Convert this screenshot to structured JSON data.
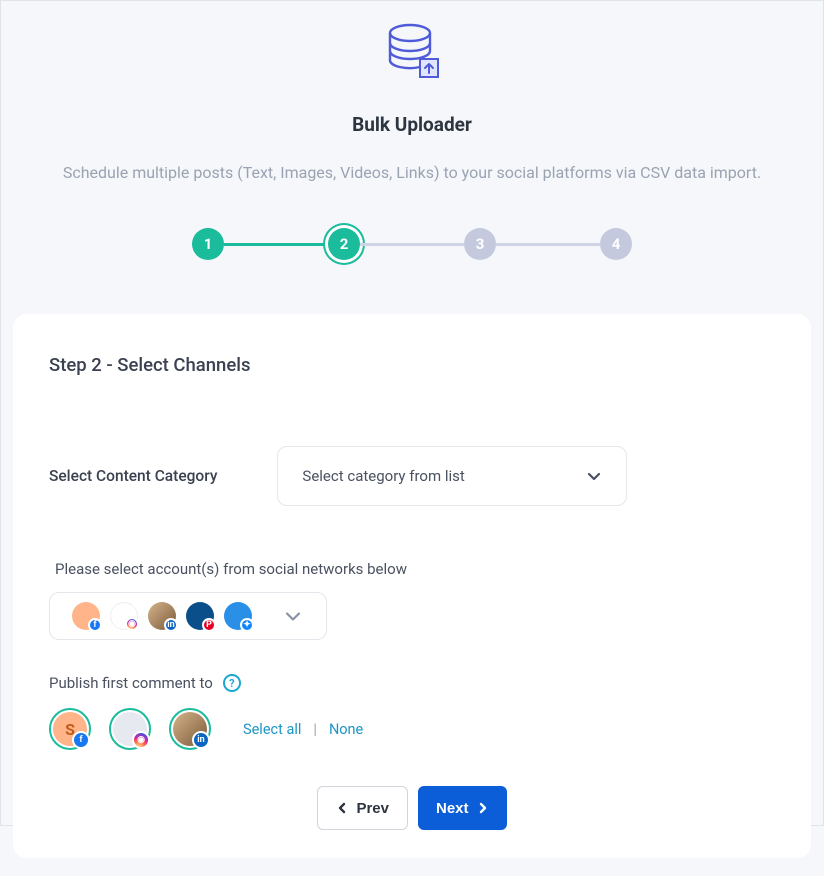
{
  "header": {
    "title": "Bulk Uploader",
    "subtitle": "Schedule multiple posts (Text, Images, Videos, Links) to your social platforms via CSV data import."
  },
  "stepper": {
    "steps": [
      "1",
      "2",
      "3",
      "4"
    ],
    "current": 2
  },
  "card": {
    "heading": "Step 2 - Select Channels",
    "category": {
      "label": "Select Content Category",
      "placeholder": "Select category from list"
    },
    "accounts": {
      "label": "Please select account(s) from social networks below"
    },
    "first_comment": {
      "label": "Publish first comment to",
      "select_all": "Select all",
      "separator": "|",
      "none": "None"
    },
    "nav": {
      "prev": "Prev",
      "next": "Next"
    }
  }
}
